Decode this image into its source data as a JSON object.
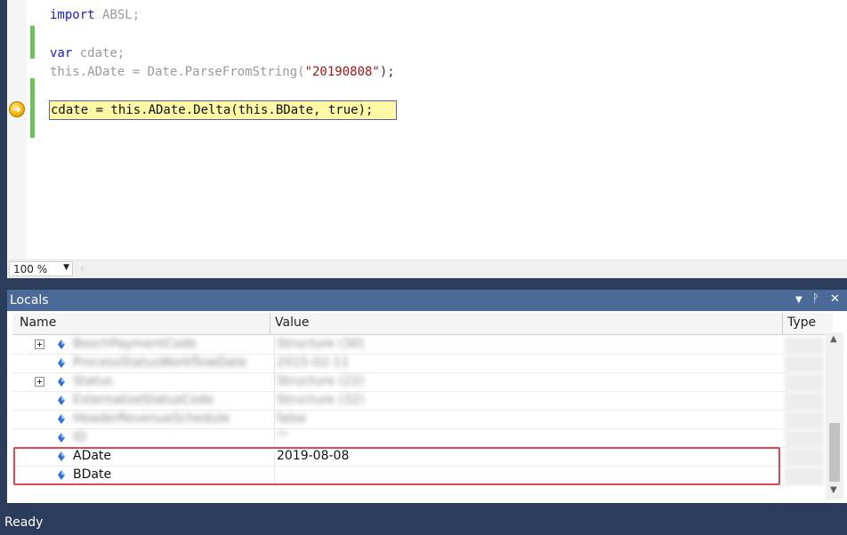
{
  "editor": {
    "lines": [
      {
        "kw": "import",
        "rest": " ABSL;"
      },
      {
        "kw": "var",
        "rest": " cdate;"
      },
      {
        "part1": "this.ADate = Date.ParseFromString(",
        "str": "\"20190808\"",
        "part2": ");"
      }
    ],
    "current_statement": "cdate = this.ADate.Delta(this.BDate, true);"
  },
  "zoom": {
    "value": "100 %"
  },
  "locals": {
    "title": "Locals",
    "columns": {
      "name": "Name",
      "value": "Value",
      "type": "Type"
    },
    "rows": [
      {
        "name": "BoschPaymentCode",
        "value": "Structure (30)"
      },
      {
        "name": "ProcessStatusWorkflowDate",
        "value": "2015-02-11"
      },
      {
        "name": "Status",
        "value": "Structure (22)"
      },
      {
        "name": "ExternalizeStatusCode",
        "value": "Structure (32)"
      },
      {
        "name": "HeaderRevenueSchedule",
        "value": "false"
      },
      {
        "name": "ID",
        "value": "\"\""
      },
      {
        "name": "ADate",
        "value": "2019-08-08"
      },
      {
        "name": "BDate",
        "value": ""
      }
    ]
  },
  "status": {
    "text": "Ready"
  },
  "colors": {
    "accent": "#4b6a97",
    "statusbar": "#2b3d5a",
    "highlight": "#e0484f",
    "current_line": "#fff9a6"
  }
}
